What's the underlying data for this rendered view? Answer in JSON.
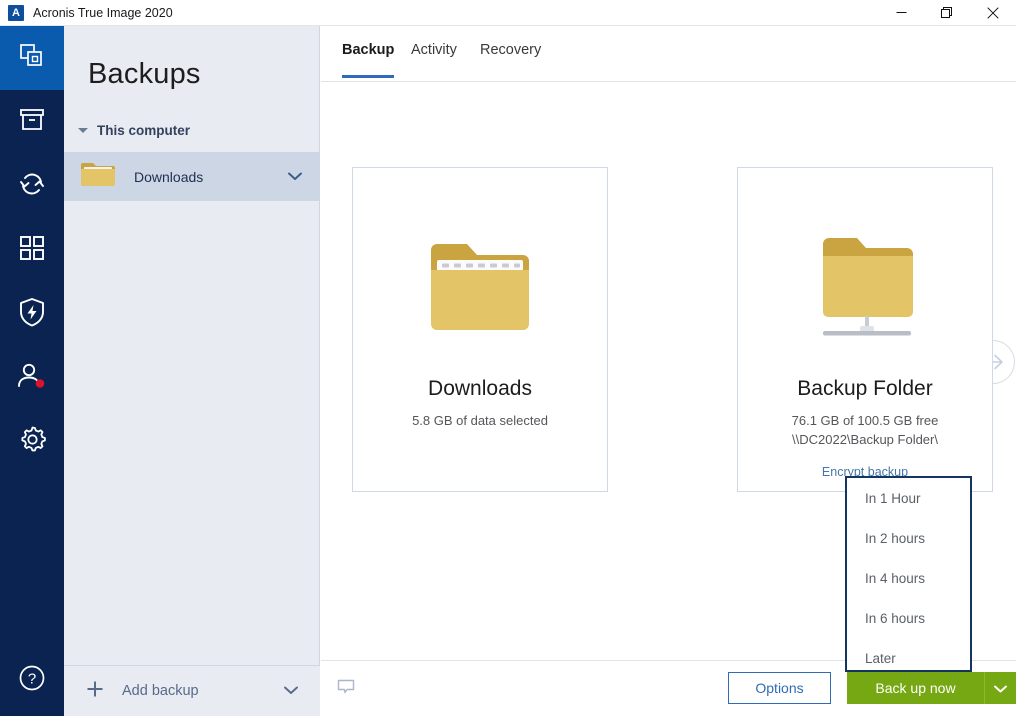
{
  "window": {
    "title": "Acronis True Image 2020",
    "logo_letter": "A",
    "controls": {
      "minimize": "minimize-button",
      "restore": "restore-button",
      "close": "close-button"
    }
  },
  "rail": {
    "items": [
      {
        "name": "backups",
        "icon": "backups-icon",
        "active": true
      },
      {
        "name": "archive",
        "icon": "archive-box-icon",
        "active": false
      },
      {
        "name": "sync",
        "icon": "sync-arrows-icon",
        "active": false
      },
      {
        "name": "tools",
        "icon": "grid-tools-icon",
        "active": false
      },
      {
        "name": "protection",
        "icon": "shield-bolt-icon",
        "active": false
      },
      {
        "name": "account",
        "icon": "user-account-icon",
        "active": false
      },
      {
        "name": "settings",
        "icon": "gear-icon",
        "active": false
      }
    ],
    "help": {
      "name": "help",
      "icon": "help-circle-icon"
    }
  },
  "sidebar": {
    "title": "Backups",
    "group": {
      "label": "This computer",
      "expanded": true
    },
    "backups": [
      {
        "name": "Downloads",
        "icon": "folder-icon",
        "selected": true
      }
    ],
    "add_backup": {
      "label": "Add backup",
      "icon": "plus-icon",
      "chevron": "chevron-down-icon"
    }
  },
  "main": {
    "tabs": [
      {
        "label": "Backup",
        "active": true
      },
      {
        "label": "Activity",
        "active": false
      },
      {
        "label": "Recovery",
        "active": false
      }
    ],
    "source_card": {
      "icon": "folder-open-papers-icon",
      "name": "Downloads",
      "detail": "5.8 GB of data selected"
    },
    "connector": {
      "icon": "arrow-right-circle-icon",
      "dots": 3
    },
    "destination_card": {
      "icon": "network-folder-icon",
      "name": "Backup Folder",
      "free_space": "76.1 GB of 100.5 GB free",
      "path": "\\\\DC2022\\Backup Folder\\",
      "encrypt_link": "Encrypt backup"
    },
    "dropdown": {
      "open": true,
      "items": [
        {
          "label": "In 1 Hour"
        },
        {
          "label": "In 2 hours"
        },
        {
          "label": "In 4 hours"
        },
        {
          "label": "In 6 hours"
        },
        {
          "label": "Later"
        }
      ]
    },
    "bottom_bar": {
      "comment_icon": "comment-bubble-icon",
      "options_label": "Options",
      "backup_label": "Back up now",
      "backup_more_icon": "chevron-down-icon"
    }
  },
  "colors": {
    "rail_bg": "#0b2351",
    "rail_active": "#0a5bad",
    "sidepanel_bg": "#e8ecf2",
    "sidepanel_selected": "#ccd6e4",
    "tab_accent": "#2f6cb5",
    "link": "#4676a8",
    "green_button": "#76a813",
    "dropdown_border": "#13355e",
    "folder_front": "#e3c568",
    "folder_back": "#c9a441"
  }
}
